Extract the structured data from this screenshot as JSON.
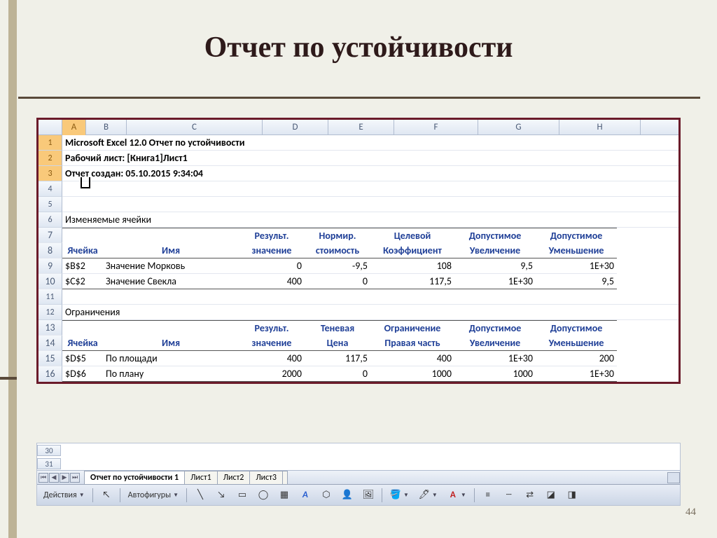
{
  "slide": {
    "title": "Отчет по устойчивости",
    "page_number": "44"
  },
  "columns": {
    "a": "A",
    "b": "B",
    "c": "C",
    "d": "D",
    "e": "E",
    "f": "F",
    "g": "G",
    "h": "H"
  },
  "rows": {
    "r1": "1",
    "r2": "2",
    "r3": "3",
    "r4": "4",
    "r5": "5",
    "r6": "6",
    "r7": "7",
    "r8": "8",
    "r9": "9",
    "r10": "10",
    "r11": "11",
    "r12": "12",
    "r13": "13",
    "r14": "14",
    "r15": "15",
    "r16": "16",
    "r30": "30",
    "r31": "31"
  },
  "report": {
    "title": "Microsoft Excel 12.0 Отчет по устойчивости",
    "worksheet": "Рабочий лист: [Книга1]Лист1",
    "created": "Отчет создан: 05.10.2015 9:34:04",
    "section1": "Изменяемые ячейки",
    "section2": "Ограничения"
  },
  "headers1": {
    "cell": "Ячейка",
    "name": "Имя",
    "result1": "Результ.",
    "result2": "значение",
    "norm1": "Нормир.",
    "norm2": "стоимость",
    "obj1": "Целевой",
    "obj2": "Коэффициент",
    "inc1": "Допустимое",
    "inc2": "Увеличение",
    "dec1": "Допустимое",
    "dec2": "Уменьшение"
  },
  "headers2": {
    "cell": "Ячейка",
    "name": "Имя",
    "result1": "Результ.",
    "result2": "значение",
    "shadow1": "Теневая",
    "shadow2": "Цена",
    "cons1": "Ограничение",
    "cons2": "Правая часть",
    "inc1": "Допустимое",
    "inc2": "Увеличение",
    "dec1": "Допустимое",
    "dec2": "Уменьшение"
  },
  "vars": [
    {
      "cell": "$B$2",
      "name": "Значение Морковь",
      "result": "0",
      "reduced": "-9,5",
      "obj": "108",
      "inc": "9,5",
      "dec": "1E+30"
    },
    {
      "cell": "$C$2",
      "name": "Значение Свекла",
      "result": "400",
      "reduced": "0",
      "obj": "117,5",
      "inc": "1E+30",
      "dec": "9,5"
    }
  ],
  "cons": [
    {
      "cell": "$D$5",
      "name": "По площади",
      "result": "400",
      "shadow": "117,5",
      "rhs": "400",
      "inc": "1E+30",
      "dec": "200"
    },
    {
      "cell": "$D$6",
      "name": "По плану",
      "result": "2000",
      "shadow": "0",
      "rhs": "1000",
      "inc": "1000",
      "dec": "1E+30"
    }
  ],
  "tabs": {
    "active": "Отчет по устойчивости 1",
    "t2": "Лист1",
    "t3": "Лист2",
    "t4": "Лист3"
  },
  "toolbar": {
    "actions": "Действия",
    "autoshapes": "Автофигуры"
  }
}
